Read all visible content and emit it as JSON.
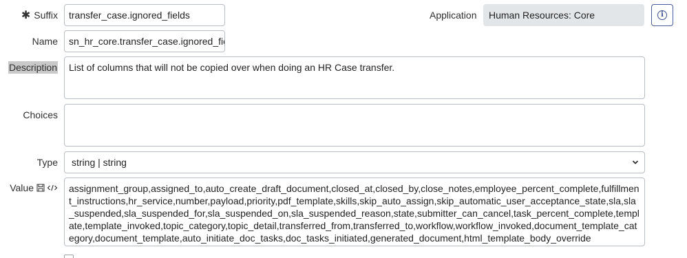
{
  "suffix": {
    "label": "Suffix",
    "value": "transfer_case.ignored_fields"
  },
  "name": {
    "label": "Name",
    "value": "sn_hr_core.transfer_case.ignored_fiel"
  },
  "application": {
    "label": "Application",
    "value": "Human Resources: Core"
  },
  "description": {
    "label": "Description",
    "value": "List of columns that will not be copied over when doing an HR Case transfer."
  },
  "choices": {
    "label": "Choices",
    "value": ""
  },
  "type": {
    "label": "Type",
    "value": "string | string"
  },
  "value_field": {
    "label": "Value",
    "value": "assignment_group,assigned_to,auto_create_draft_document,closed_at,closed_by,close_notes,employee_percent_complete,fulfillment_instructions,hr_service,number,payload,priority,pdf_template,skills,skip_auto_assign,skip_automatic_user_acceptance_state,sla,sla_suspended,sla_suspended_for,sla_suspended_on,sla_suspended_reason,state,submitter_can_cancel,task_percent_complete,template,template_invoked,topic_category,topic_detail,transferred_from,transferred_to,workflow,workflow_invoked,document_template_category,document_template,auto_initiate_doc_tasks,doc_tasks_initiated,generated_document,html_template_body_override"
  },
  "icons": {
    "required": "asterisk-icon",
    "info": "info-icon",
    "save": "save-icon",
    "code": "code-icon",
    "chevron": "chevron-down-icon"
  }
}
